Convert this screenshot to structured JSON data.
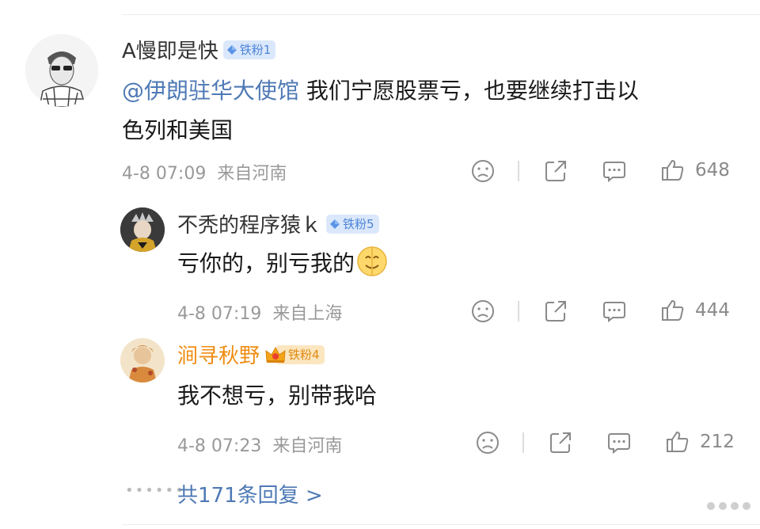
{
  "comment": {
    "username": "A慢即是快",
    "fan_badge": "铁粉1",
    "mention": "@伊朗驻华大使馆",
    "text_line1": " 我们宁愿股票亏，也要继续打击以",
    "text_line2": "色列和美国",
    "time": "4-8 07:09",
    "location": "来自河南",
    "likes": "648"
  },
  "replies": [
    {
      "username": "不秃的程序猿ｋ",
      "fan_badge": "铁粉5",
      "text": "亏你的，别亏我的",
      "time": "4-8 07:19",
      "location": "来自上海",
      "likes": "444"
    },
    {
      "username": "涧寻秋野",
      "fan_badge": "铁粉4",
      "text": "我不想亏，别带我哈",
      "time": "4-8 07:23",
      "location": "来自河南",
      "likes": "212"
    }
  ],
  "more_replies": "共171条回复 >",
  "colors": {
    "link": "#4e79b5",
    "vip_name": "#f08c12",
    "meta": "#999999",
    "badge_bg": "#dbe8fb"
  },
  "icons": [
    "dislike-icon",
    "share-icon",
    "comment-icon",
    "like-icon",
    "diamond-icon",
    "crown-icon",
    "emoji-icon"
  ]
}
